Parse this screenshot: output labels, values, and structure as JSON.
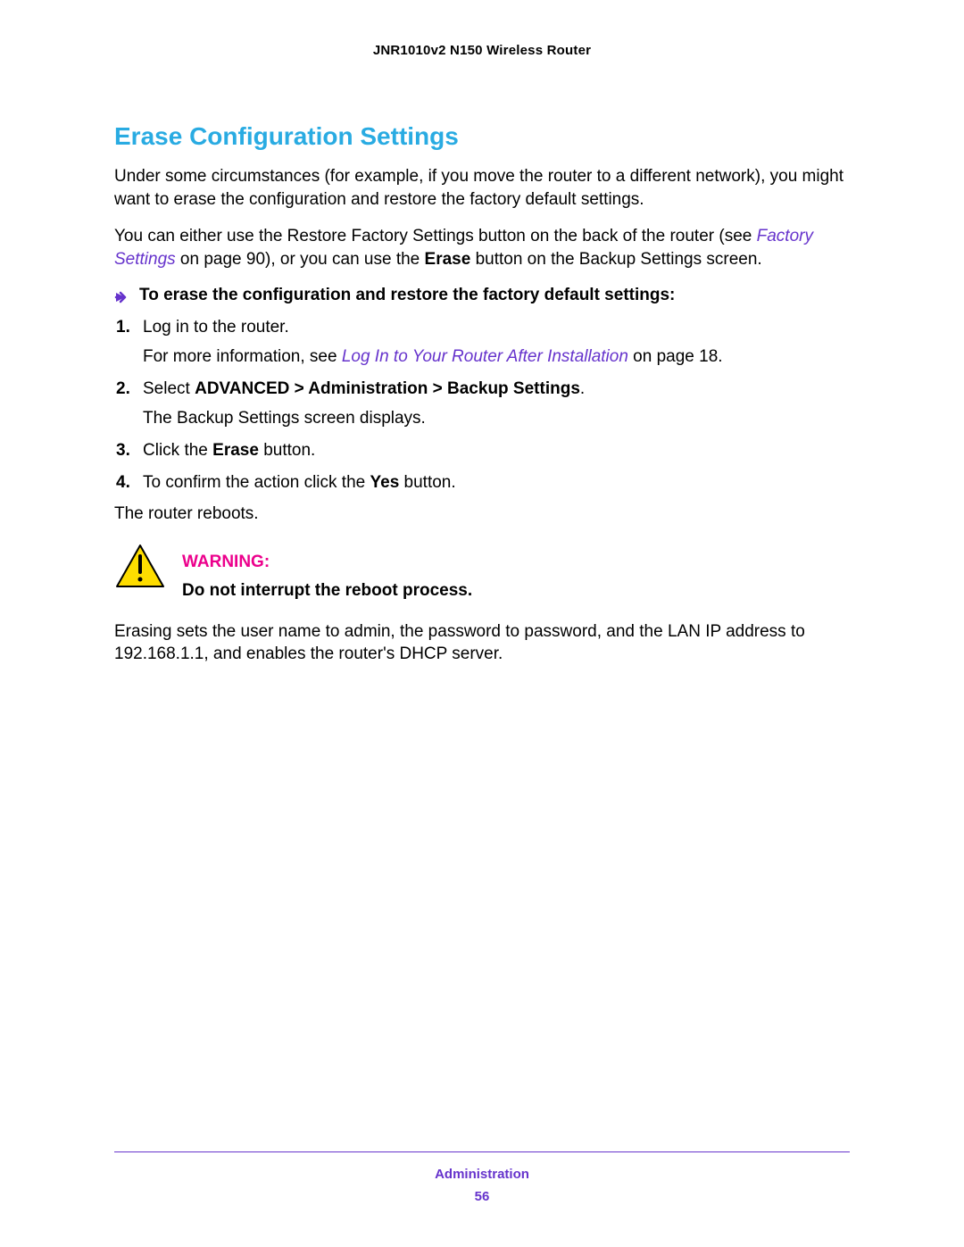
{
  "header": {
    "title": "JNR1010v2 N150 Wireless Router"
  },
  "section": {
    "title": "Erase Configuration Settings",
    "p1": "Under some circumstances (for example, if you move the router to a different network), you might want to erase the configuration and restore the factory default settings.",
    "p2_a": "You can either use the Restore Factory Settings button on the back of the router (see ",
    "p2_link": "Factory Settings",
    "p2_b": " on page 90), or you can use the ",
    "p2_bold": "Erase",
    "p2_c": " button on the Backup Settings screen.",
    "intro": "To erase the configuration and restore the factory default settings:",
    "steps": {
      "s1": {
        "num": "1.",
        "text": "Log in to the router.",
        "extra_a": "For more information, see ",
        "extra_link": "Log In to Your Router After Installation",
        "extra_b": " on page 18."
      },
      "s2": {
        "num": "2.",
        "text_a": "Select ",
        "text_bold": "ADVANCED > Administration > Backup Settings",
        "text_b": ".",
        "extra": "The Backup Settings screen displays."
      },
      "s3": {
        "num": "3.",
        "text_a": "Click the ",
        "text_bold": "Erase",
        "text_b": " button."
      },
      "s4": {
        "num": "4.",
        "text_a": "To confirm the action click the ",
        "text_bold": "Yes",
        "text_b": " button."
      }
    },
    "conclusion": "The router reboots.",
    "warning": {
      "label": "WARNING:",
      "body": "Do not interrupt the reboot process."
    },
    "p3": "Erasing sets the user name to admin, the password to password, and the LAN IP address to 192.168.1.1, and enables the router's DHCP server."
  },
  "footer": {
    "admin": "Administration",
    "page": "56"
  }
}
